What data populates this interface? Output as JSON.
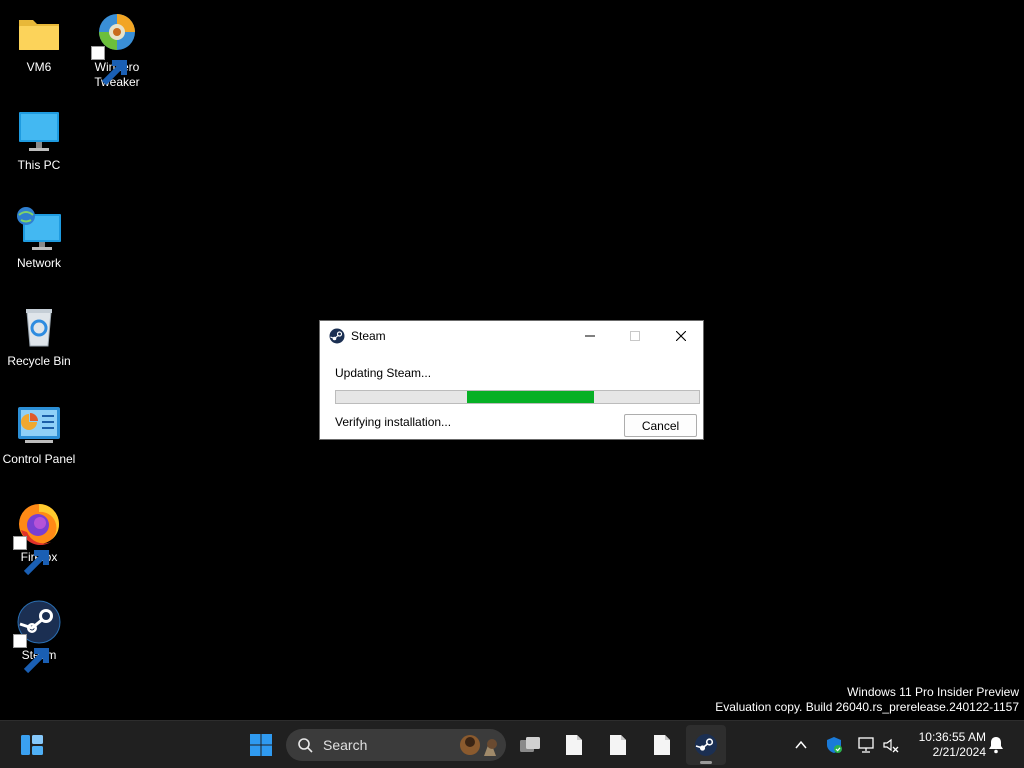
{
  "desktop": {
    "icons": [
      {
        "label": "VM6",
        "icon": "folder-icon"
      },
      {
        "label": "Winaero\nTweaker",
        "icon": "winaero-tweaker-icon",
        "shortcut": true
      },
      {
        "label": "This PC",
        "icon": "this-pc-icon"
      },
      {
        "label": "Network",
        "icon": "network-icon"
      },
      {
        "label": "Recycle Bin",
        "icon": "recycle-bin-icon"
      },
      {
        "label": "Control Panel",
        "icon": "control-panel-icon"
      },
      {
        "label": "Firefox",
        "icon": "firefox-icon",
        "shortcut": true
      },
      {
        "label": "Steam",
        "icon": "steam-icon",
        "shortcut": true
      }
    ],
    "watermark": {
      "line1": "Windows 11 Pro Insider Preview",
      "line2": "Evaluation copy. Build 26040.rs_prerelease.240122-1157"
    }
  },
  "dialog": {
    "title": "Steam",
    "status": "Updating Steam...",
    "detail": "Verifying installation...",
    "cancel_label": "Cancel",
    "progress": {
      "start": 0.36,
      "end": 0.71,
      "color": "#06b025"
    }
  },
  "taskbar": {
    "search_label": "Search",
    "time": "10:36:55 AM",
    "date": "2/21/2024",
    "accent": "#0078d4"
  }
}
